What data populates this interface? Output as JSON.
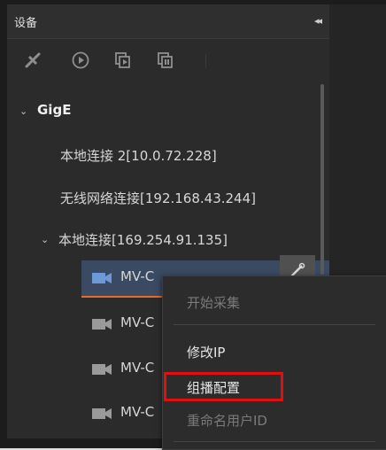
{
  "panel": {
    "title": "设备",
    "collapse_glyph": "◂◂"
  },
  "toolbar": {
    "icons": [
      "disconnect-icon",
      "play-icon",
      "start-grab-icon",
      "stop-grab-icon"
    ]
  },
  "tree": {
    "group": "GigE",
    "connections": [
      "本地连接 2[10.0.72.228]",
      "无线网络连接[192.168.43.244]",
      "本地连接[169.254.91.135]"
    ],
    "devices": [
      {
        "label": "MV-C",
        "selected": true
      },
      {
        "label": "MV-C",
        "selected": false
      },
      {
        "label": "MV-C",
        "selected": false
      },
      {
        "label": "MV-C",
        "selected": false
      }
    ]
  },
  "context_menu": {
    "items": [
      {
        "label": "开始采集",
        "enabled": false
      },
      {
        "label": "修改IP",
        "enabled": true
      },
      {
        "label": "组播配置",
        "enabled": true,
        "highlighted": true
      },
      {
        "label": "重命名用户ID",
        "enabled": false
      }
    ]
  },
  "colors": {
    "selection": "#3a4a62",
    "selection_underline": "#e86c25",
    "highlight_box": "#e01010"
  }
}
